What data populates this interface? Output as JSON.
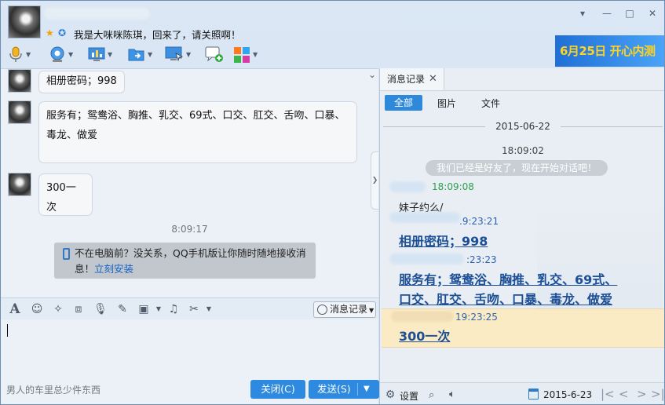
{
  "header": {
    "signature": "我是大咪咪陈琪，回来了，请关照啊！",
    "window_buttons": [
      "▾",
      "—",
      "□",
      "✕"
    ]
  },
  "toolbar": {
    "items": [
      "voice-icon",
      "video-icon",
      "screen-share-icon",
      "file-transfer-icon",
      "remote-desktop-icon",
      "sms-icon",
      "apps-icon"
    ]
  },
  "ad_banner": {
    "text": "6月25日 开心内测"
  },
  "chat": {
    "messages": [
      {
        "text": "相册密码；998"
      },
      {
        "text": "服务有；鸳鸯浴、胸推、乳交、69式、口交、肛交、舌吻、口暴、毒龙、做爱"
      },
      {
        "text": "300一次"
      }
    ],
    "time": "8:09:17",
    "notice": {
      "text": "不在电脑前？没关系，QQ手机版让你随时随地接收消息！",
      "link": "立刻安装"
    }
  },
  "compose": {
    "history_button": "消息记录",
    "ad_text": "男人的车里总少件东西",
    "close_button": "关闭(C)",
    "send_button": "发送(S)"
  },
  "history": {
    "tab_label": "消息记录",
    "filters": [
      "全部",
      "图片",
      "文件"
    ],
    "date": "2015-06-22",
    "sys_time": "18:09:02",
    "sys_msg": "我们已经是好友了，现在开始对话吧！",
    "entries": [
      {
        "time": "18:09:08",
        "text": "妹子约么/"
      },
      {
        "time": ".9:23:21",
        "text": "相册密码；998"
      },
      {
        "time": ":23:23",
        "text_line1": "服务有；鸳鸯浴、胸推、乳交、69式、",
        "text_line2": "口交、肛交、舌吻、口暴、毒龙、做爱"
      },
      {
        "time": "19:23:25",
        "text": "300一次"
      }
    ],
    "settings_label": "设置",
    "current_date": "2015-6-23",
    "colors": {
      "accent": "#2d8ae0",
      "highlight": "#fbebc4",
      "link": "#1c4f96"
    }
  }
}
